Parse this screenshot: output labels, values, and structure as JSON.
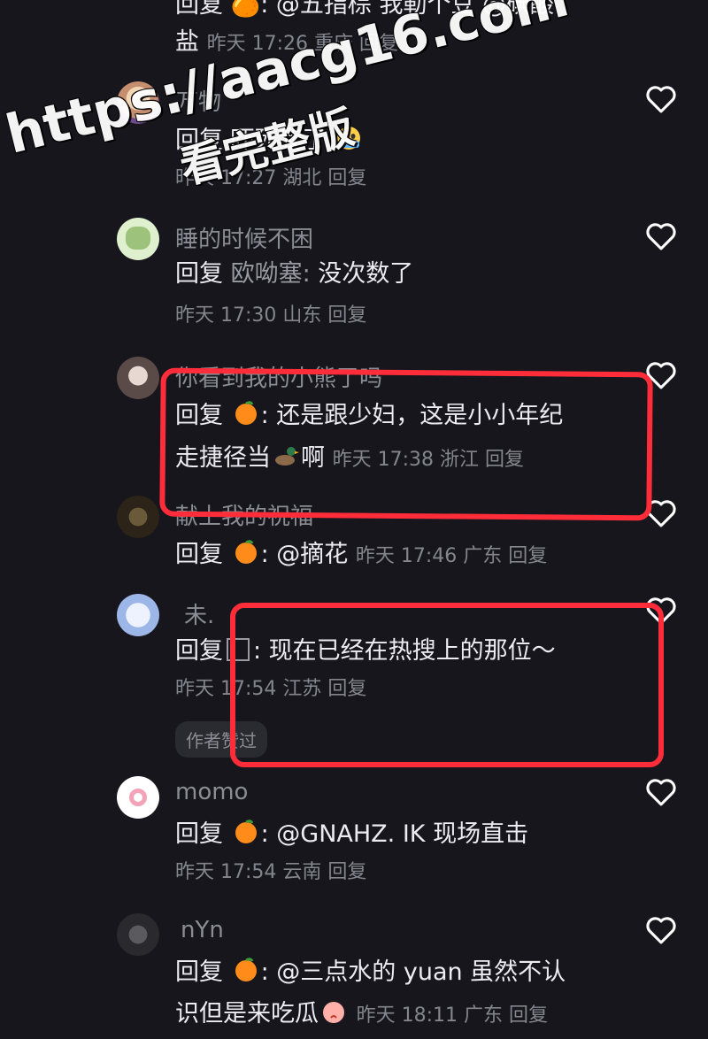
{
  "top": {
    "line1": "回复 🍊: @五指棕 我勒个豆 @碘酸",
    "line2_text": "盐",
    "line2_meta": "昨天 17:26 重庆 回复"
  },
  "replies": [
    {
      "name": "万物",
      "kw": "回复",
      "target": "",
      "text": "吓死我了",
      "meta": "昨天 17:27 湖北 回复"
    },
    {
      "name": "睡的时候不困",
      "kw": "回复",
      "target": "欧呦塞:",
      "text": "没次数了",
      "meta": "昨天 17:30 山东 回复"
    },
    {
      "name": "你看到我的小熊了吗",
      "kw": "回复",
      "text1": ": 还是跟少妇，这是小小年纪",
      "text2a": "走捷径当",
      "text2b": "啊",
      "meta": "昨天 17:38 浙江 回复"
    },
    {
      "name": "献上我的祝福",
      "kw": "回复",
      "text": ": @摘花",
      "meta": "昨天 17:46 广东 回复"
    },
    {
      "name": "未.",
      "kw": "回复",
      "text": ": 现在已经在热搜上的那位～",
      "meta": "昨天 17:54 江苏 回复",
      "tag": "作者赞过"
    },
    {
      "name": "momo",
      "kw": "回复",
      "text": ": @GNAHZ. IK 现场直击",
      "meta": "昨天 17:54 云南 回复"
    },
    {
      "name": "nYn",
      "kw": "回复",
      "text1": ": @三点水的 yuan 虽然不认",
      "text2": "识但是来吃瓜",
      "meta": "昨天 18:11 广东 回复"
    }
  ],
  "watermark": {
    "url": "https://aacg16.com",
    "sub": "看完整版"
  },
  "icons": {
    "heart": "heart-outline-icon",
    "orange": "orange-emoji",
    "duck": "duck-emoji",
    "crying": "crying-emoji",
    "peach": "peach-emoji"
  },
  "colors": {
    "background": "#16161c",
    "highlight_box": "#ff2d3a"
  }
}
